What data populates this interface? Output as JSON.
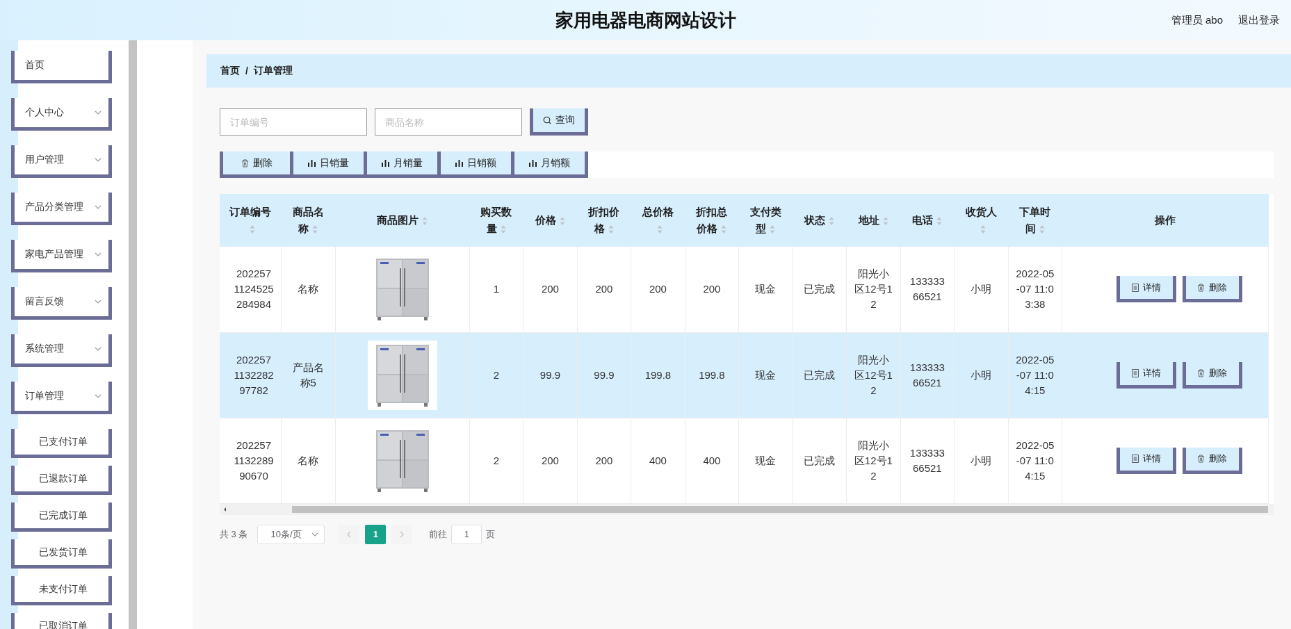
{
  "header": {
    "title": "家用电器电商网站设计",
    "user": "管理员 abo",
    "logout": "退出登录"
  },
  "sidebar": {
    "items": [
      {
        "label": "首页",
        "kind": "link"
      },
      {
        "label": "个人中心",
        "kind": "submenu"
      },
      {
        "label": "用户管理",
        "kind": "submenu"
      },
      {
        "label": "产品分类管理",
        "kind": "submenu"
      },
      {
        "label": "家电产品管理",
        "kind": "submenu"
      },
      {
        "label": "留言反馈",
        "kind": "submenu"
      },
      {
        "label": "系统管理",
        "kind": "submenu"
      },
      {
        "label": "订单管理",
        "kind": "submenu",
        "expanded": true,
        "children": [
          {
            "label": "已支付订单"
          },
          {
            "label": "已退款订单"
          },
          {
            "label": "已完成订单"
          },
          {
            "label": "已发货订单"
          },
          {
            "label": "未支付订单"
          },
          {
            "label": "已取消订单"
          }
        ]
      }
    ]
  },
  "breadcrumb": {
    "items": [
      "首页",
      "订单管理"
    ],
    "separator": "/"
  },
  "search": {
    "fields": [
      {
        "placeholder": "订单编号"
      },
      {
        "placeholder": "商品名称"
      }
    ],
    "button": "查询"
  },
  "toolbar": [
    {
      "label": "删除",
      "kind": "delete"
    },
    {
      "label": "日销量",
      "kind": "chart"
    },
    {
      "label": "月销量",
      "kind": "chart"
    },
    {
      "label": "日销额",
      "kind": "chart"
    },
    {
      "label": "月销额",
      "kind": "chart"
    }
  ],
  "table": {
    "columns": [
      {
        "label": "订单编号",
        "kind": "text",
        "sortable": true
      },
      {
        "label": "商品名称",
        "kind": "text",
        "sortable": true
      },
      {
        "label": "商品图片",
        "kind": "picture",
        "sortable": true
      },
      {
        "label": "购买数量",
        "kind": "text",
        "sortable": true
      },
      {
        "label": "价格",
        "kind": "text",
        "sortable": true
      },
      {
        "label": "折扣价格",
        "kind": "text",
        "sortable": true
      },
      {
        "label": "总价格",
        "kind": "text",
        "sortable": true
      },
      {
        "label": "折扣总价格",
        "kind": "text",
        "sortable": true
      },
      {
        "label": "支付类型",
        "kind": "text",
        "sortable": true
      },
      {
        "label": "状态",
        "kind": "text",
        "sortable": true
      },
      {
        "label": "地址",
        "kind": "text",
        "sortable": true
      },
      {
        "label": "电话",
        "kind": "text",
        "sortable": true
      },
      {
        "label": "收货人",
        "kind": "text",
        "sortable": true
      },
      {
        "label": "下单时间",
        "kind": "text",
        "sortable": true
      },
      {
        "label": "操作",
        "kind": "actions",
        "sortable": false
      }
    ],
    "rows": [
      {
        "highlighted": false,
        "cells": [
          "2022571124525284984",
          "名称",
          {
            "kind": "picture"
          },
          "1",
          "200",
          "200",
          "200",
          "200",
          "现金",
          "已完成",
          "阳光小区12号12",
          "13333366521",
          "小明",
          "2022-05-07 11:03:38",
          [
            {
              "label": "详情",
              "kind": "detail"
            },
            {
              "label": "删除",
              "kind": "delete"
            }
          ]
        ]
      },
      {
        "highlighted": true,
        "cells": [
          "202257113228297782",
          "产品名称5",
          {
            "kind": "picture"
          },
          "2",
          "99.9",
          "99.9",
          "199.8",
          "199.8",
          "现金",
          "已完成",
          "阳光小区12号12",
          "13333366521",
          "小明",
          "2022-05-07 11:04:15",
          [
            {
              "label": "详情",
              "kind": "detail"
            },
            {
              "label": "删除",
              "kind": "delete"
            }
          ]
        ]
      },
      {
        "highlighted": false,
        "cells": [
          "202257113228990670",
          "名称",
          {
            "kind": "picture"
          },
          "2",
          "200",
          "200",
          "400",
          "400",
          "现金",
          "已完成",
          "阳光小区12号12",
          "13333366521",
          "小明",
          "2022-05-07 11:04:15",
          [
            {
              "label": "详情",
              "kind": "detail"
            },
            {
              "label": "删除",
              "kind": "delete"
            }
          ]
        ]
      }
    ]
  },
  "pagination": {
    "total": "共 3 条",
    "page_size": "10条/页",
    "pages": [
      {
        "label": "1",
        "selected": true
      }
    ],
    "goto_label": "前往",
    "goto_value": "1",
    "goto_suffix": "页"
  }
}
